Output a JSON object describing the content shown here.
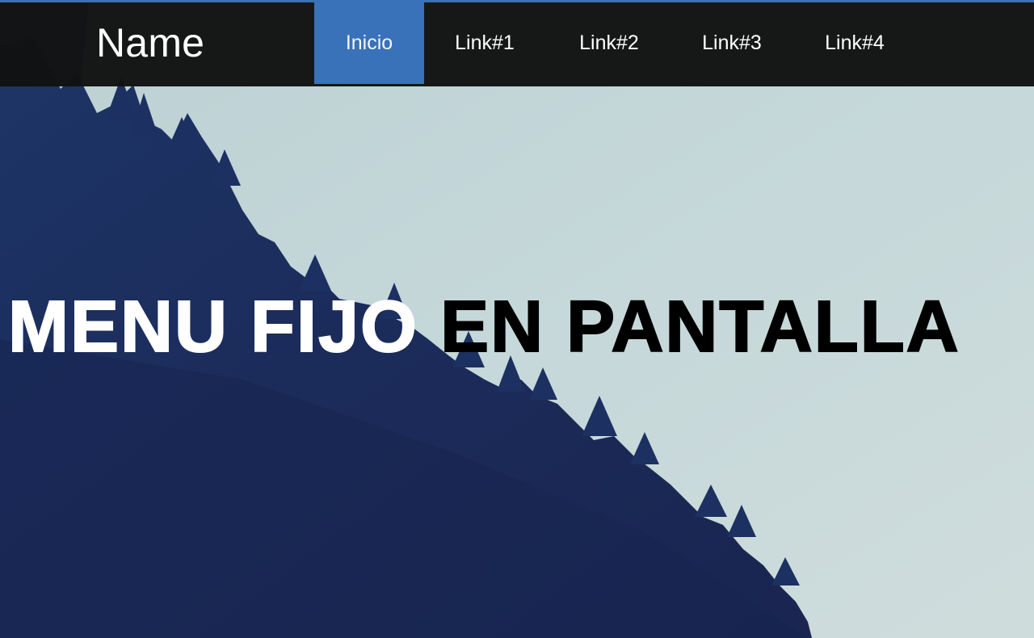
{
  "colors": {
    "accent": "#3a72b9",
    "navbar_bg": "#111212",
    "sky": "#c4d6d9",
    "forest": "#1b2a55",
    "title_light": "#ffffff",
    "title_dark": "#000000"
  },
  "navbar": {
    "brand": "Name",
    "items": [
      {
        "label": "Inicio",
        "active": true
      },
      {
        "label": "Link#1",
        "active": false
      },
      {
        "label": "Link#2",
        "active": false
      },
      {
        "label": "Link#3",
        "active": false
      },
      {
        "label": "Link#4",
        "active": false
      }
    ]
  },
  "hero": {
    "title_part1": "MENU FIJO",
    "title_part2": "EN PANTALLA",
    "background": "forest-mountainside-photo"
  }
}
